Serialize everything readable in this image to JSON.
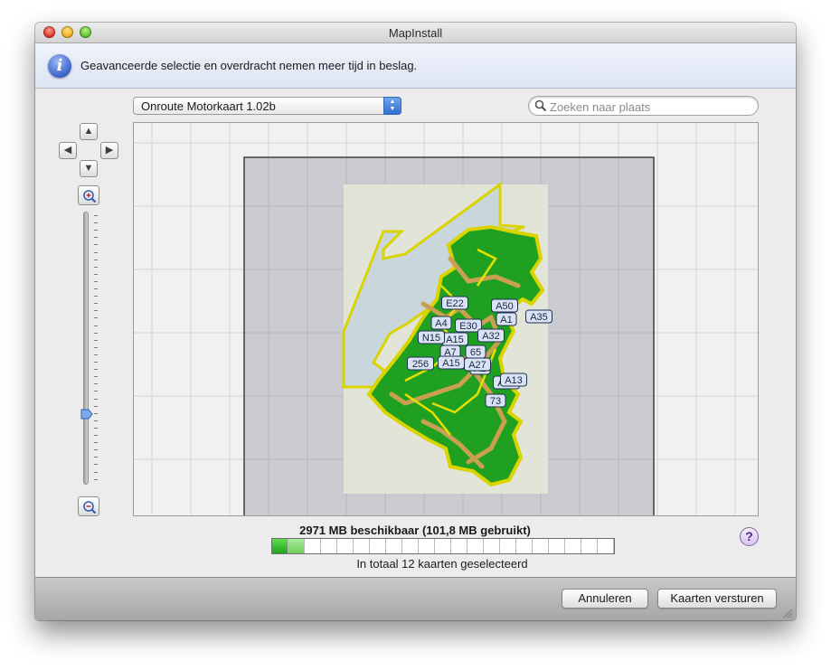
{
  "window": {
    "title": "MapInstall"
  },
  "info": {
    "message": "Geavanceerde selectie en overdracht nemen meer tijd in beslag."
  },
  "toolbar": {
    "map_product": "Onroute Motorkaart 1.02b",
    "search_placeholder": "Zoeken naar plaats"
  },
  "navigation": {
    "pan_up": "▲",
    "pan_left": "◀",
    "pan_right": "▶",
    "pan_down": "▼"
  },
  "zoom": {
    "level_fraction": 0.25
  },
  "map": {
    "road_labels": [
      "E22",
      "A4",
      "E30",
      "A15",
      "A32",
      "A50",
      "A1",
      "A35",
      "N15",
      "A7",
      "65",
      "A2",
      "A27",
      "A13",
      "256",
      "A15",
      "73",
      "A13"
    ]
  },
  "capacity": {
    "text": "2971 MB beschikbaar (101,8 MB gebruikt)",
    "used_segments": 2,
    "total_segments": 21
  },
  "selection": {
    "text": "In totaal 12 kaarten geselecteerd"
  },
  "help": {
    "label": "?"
  },
  "buttons": {
    "cancel": "Annuleren",
    "send": "Kaarten versturen"
  },
  "colors": {
    "accent": "#2f6fd3",
    "tile_border": "#d9d400",
    "land": "#1f9d1f"
  }
}
